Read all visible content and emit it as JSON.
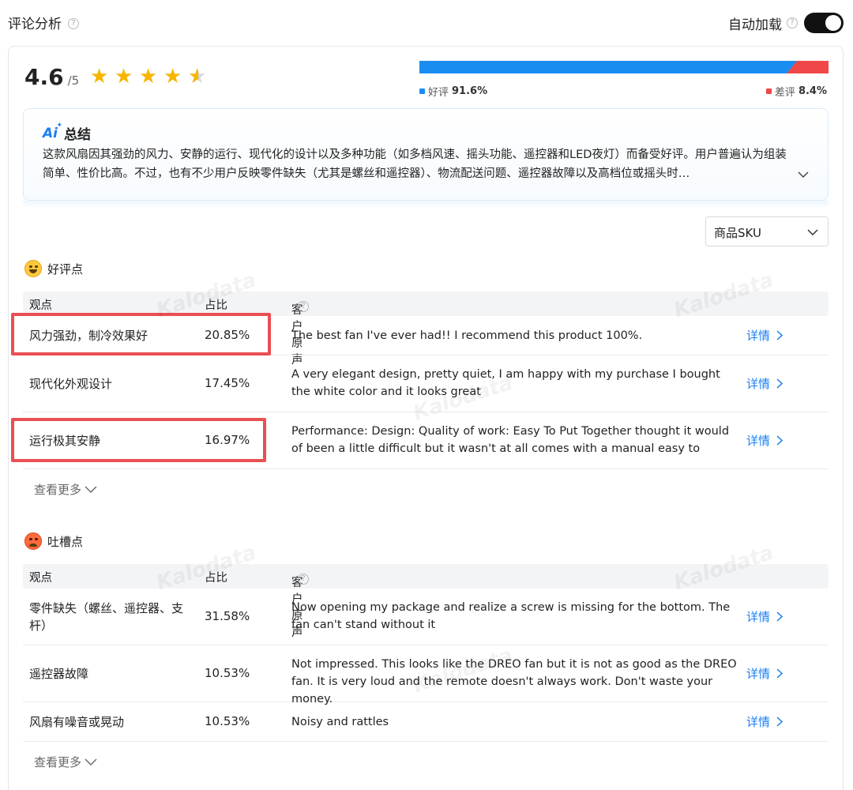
{
  "header": {
    "title": "评论分析",
    "auto_load_label": "自动加载",
    "help_glyph": "?",
    "auto_load_on": true
  },
  "rating": {
    "score": "4.6",
    "denominator": "/5",
    "stars_value": 4.5,
    "good_label": "好评",
    "good_pct": "91.6%",
    "good_fraction": 0.916,
    "bad_label": "差评",
    "bad_pct": "8.4%",
    "bad_fraction": 0.084
  },
  "ai_summary": {
    "title": "总结",
    "icon_text": "Ai",
    "text": "这款风扇因其强劲的风力、安静的运行、现代化的设计以及多种功能（如多档风速、摇头功能、遥控器和LED夜灯）而备受好评。用户普遍认为组装简单、性价比高。不过，也有不少用户反映零件缺失（尤其是螺丝和遥控器）、物流配送问题、遥控器故障以及高档位或摇头时…"
  },
  "sku_select": {
    "value": "商品SKU"
  },
  "positive": {
    "title": "好评点",
    "columns": [
      "观点",
      "占比",
      "客户原声"
    ],
    "rows": [
      {
        "view": "风力强劲，制冷效果好",
        "pct": "20.85%",
        "quote": "The best fan I've ever had!! I recommend this product 100%.",
        "detail": "详情",
        "highlighted": true
      },
      {
        "view": "现代化外观设计",
        "pct": "17.45%",
        "quote": "A very elegant design, pretty quiet, I am happy with my purchase I bought the white color and it looks great",
        "detail": "详情",
        "highlighted": false
      },
      {
        "view": "运行极其安静",
        "pct": "16.97%",
        "quote": "Performance: Design: Quality of work: Easy To Put Together thought it would of been a little difficult but it wasn't at all comes with a manual easy to understand…",
        "detail": "详情",
        "highlighted": true
      }
    ],
    "more_label": "查看更多"
  },
  "negative": {
    "title": "吐槽点",
    "columns": [
      "观点",
      "占比",
      "客户原声"
    ],
    "rows": [
      {
        "view": "零件缺失（螺丝、遥控器、支杆）",
        "pct": "31.58%",
        "quote": "Now opening my package and realize a screw is missing for the bottom. The fan can't stand without it",
        "detail": "详情"
      },
      {
        "view": "遥控器故障",
        "pct": "10.53%",
        "quote": "Not impressed. This looks like the DREO fan but it is not as good as the DREO fan. It is very loud and the remote doesn't always work. Don't waste your money.",
        "detail": "详情"
      },
      {
        "view": "风扇有噪音或晃动",
        "pct": "10.53%",
        "quote": "Noisy and rattles",
        "detail": "详情"
      }
    ],
    "more_label": "查看更多"
  },
  "watermark": "Kalodata",
  "colors": {
    "good": "#1a8ef0",
    "bad": "#f04848",
    "link": "#1a7ff0",
    "star": "#f7b500",
    "highlight": "#ea4f52"
  }
}
